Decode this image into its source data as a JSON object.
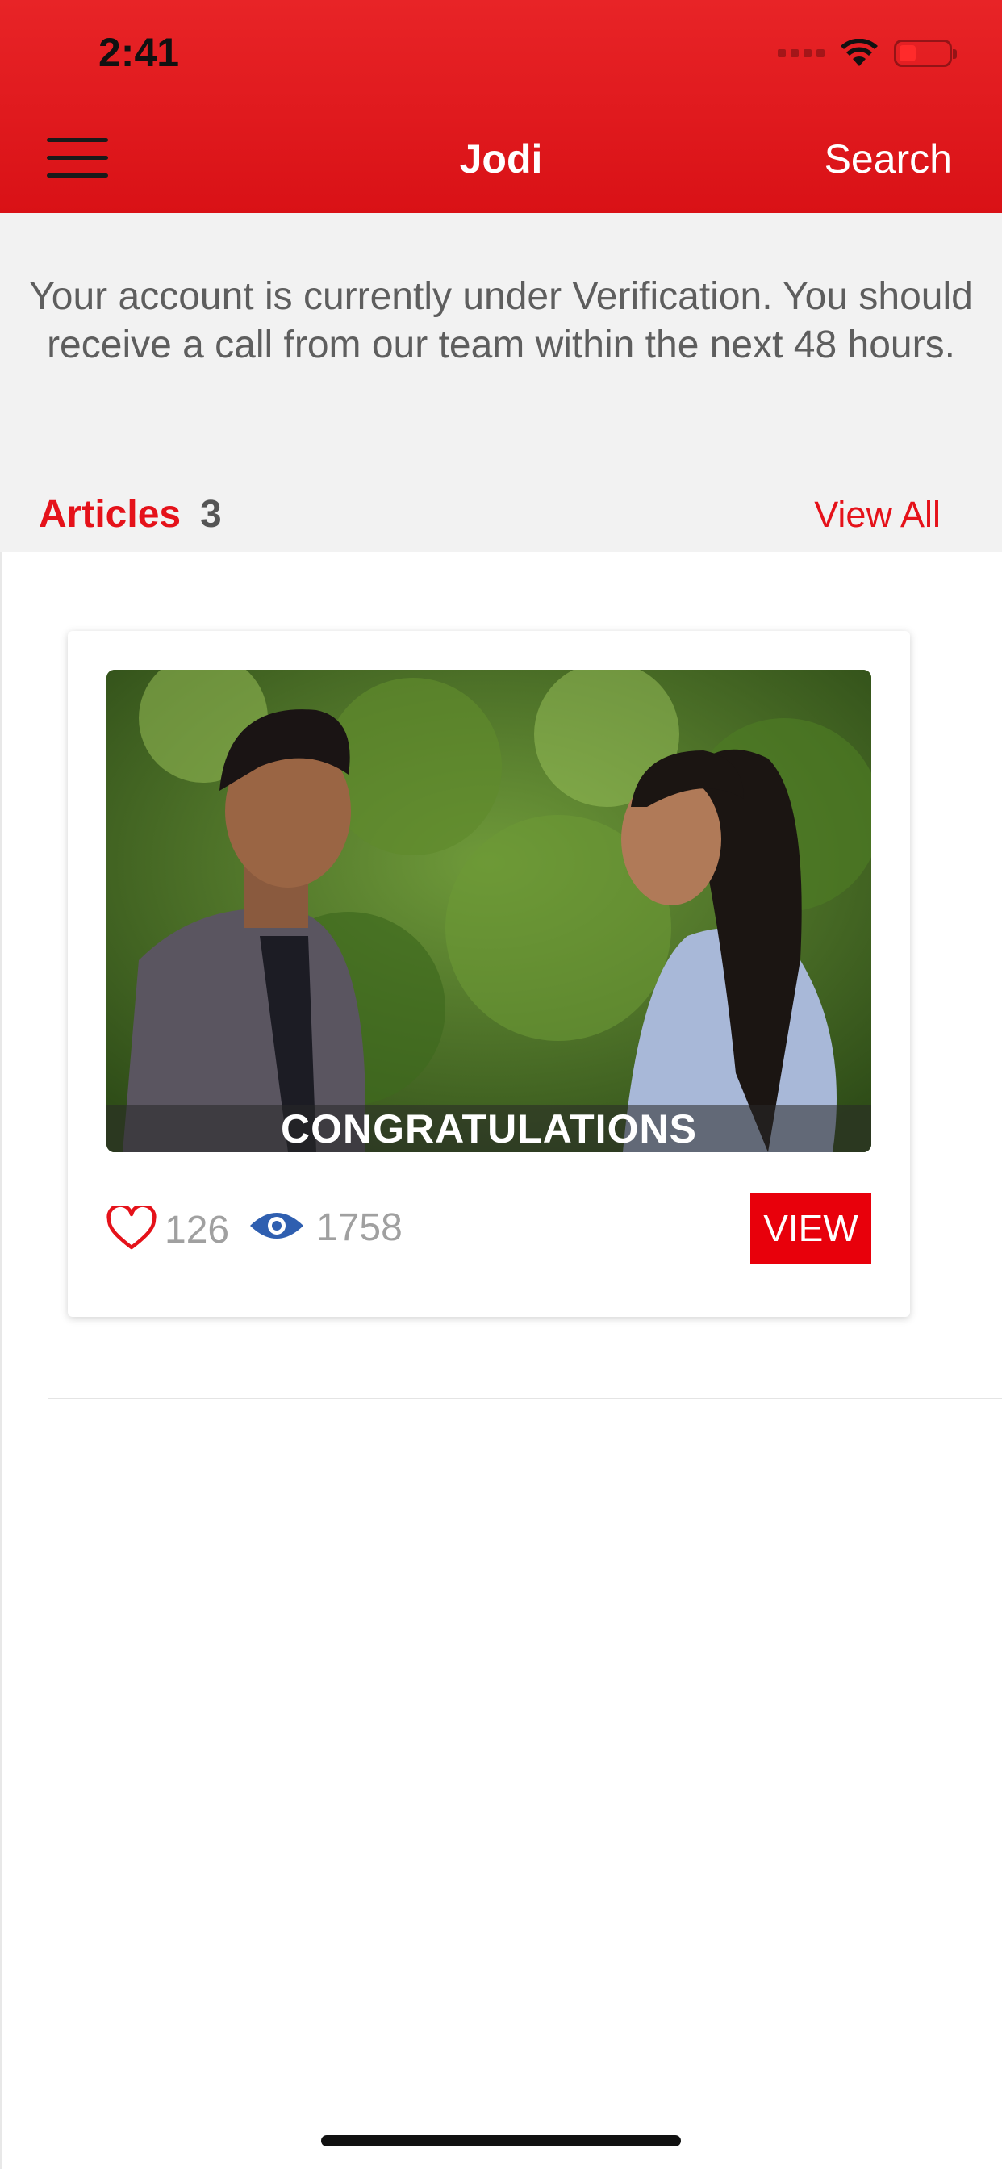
{
  "status_bar": {
    "time": "2:41"
  },
  "nav": {
    "title": "Jodi",
    "search_label": "Search"
  },
  "notice": {
    "text": "Your account is currently under Verification. You should receive a call from our team within the next 48 hours."
  },
  "articles": {
    "label": "Articles",
    "count": "3",
    "view_all_label": "View All",
    "items": [
      {
        "caption": "CONGRATULATIONS",
        "likes": "126",
        "views": "1758",
        "view_label": "VIEW"
      }
    ]
  },
  "colors": {
    "accent": "#e5121a",
    "nav_bar": "#e01c20",
    "eye_icon": "#2f5fb0"
  },
  "icons": [
    "menu-icon",
    "heart-icon",
    "eye-icon",
    "wifi-icon",
    "battery-icon",
    "signal-icon"
  ]
}
